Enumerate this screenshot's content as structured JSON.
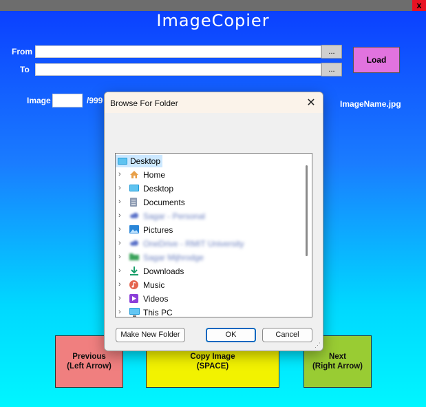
{
  "app": {
    "title": "ImageCopier",
    "close_glyph": "x"
  },
  "form": {
    "from_label": "From",
    "to_label": "To",
    "from_value": "",
    "to_value": "",
    "browse_label": "...",
    "load_label": "Load",
    "image_label": "Image",
    "image_number": "",
    "image_total": "/999",
    "image_name": "ImageName.jpg"
  },
  "buttons": {
    "previous_line1": "Previous",
    "previous_line2": "(Left Arrow)",
    "copy_line1": "Copy Image",
    "copy_line2": "(SPACE)",
    "next_line1": "Next",
    "next_line2": "(Right Arrow)"
  },
  "colors": {
    "previous": "#f07f7f",
    "copy": "#f2f200",
    "next": "#99cc33",
    "load": "#e173df"
  },
  "dialog": {
    "title": "Browse For Folder",
    "close_glyph": "✕",
    "root_item": {
      "label": "Desktop",
      "icon": "desktop-icon"
    },
    "items": [
      {
        "label": "Home",
        "icon": "home-icon",
        "blurred": false
      },
      {
        "label": "Desktop",
        "icon": "desktop-icon",
        "blurred": false
      },
      {
        "label": "Documents",
        "icon": "documents-icon",
        "blurred": false
      },
      {
        "label": "Sagar - Personal",
        "icon": "cloud-icon",
        "blurred": true
      },
      {
        "label": "Pictures",
        "icon": "pictures-icon",
        "blurred": false
      },
      {
        "label": "OneDrive - RMIT University",
        "icon": "cloud-icon",
        "blurred": true
      },
      {
        "label": "Sagar Mijhrodge",
        "icon": "folder-icon",
        "blurred": true
      },
      {
        "label": "Downloads",
        "icon": "downloads-icon",
        "blurred": false
      },
      {
        "label": "Music",
        "icon": "music-icon",
        "blurred": false
      },
      {
        "label": "Videos",
        "icon": "videos-icon",
        "blurred": false
      },
      {
        "label": "This PC",
        "icon": "pc-icon",
        "blurred": false
      }
    ],
    "make_new_folder_label": "Make New Folder",
    "ok_label": "OK",
    "cancel_label": "Cancel"
  }
}
